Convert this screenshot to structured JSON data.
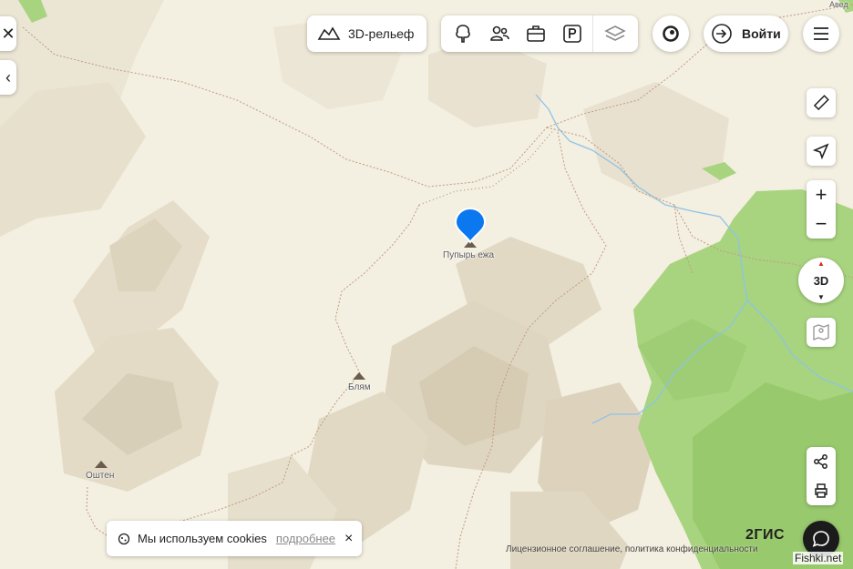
{
  "toolbar": {
    "relief_label": "3D-рельеф",
    "login_label": "Войти"
  },
  "map": {
    "labels": {
      "pupyr": "Пупырь ежа",
      "blyam": "Блям",
      "oshten": "Оштен",
      "corner": "Авед"
    }
  },
  "controls": {
    "compass_label": "3D"
  },
  "cookies": {
    "text": "Мы используем cookies",
    "link": "подробнее",
    "close": "×"
  },
  "footer": {
    "brand": "2ГИС",
    "legal": "Лицензионное соглашение, политика конфиденциальности",
    "watermark": "Fishki.net"
  }
}
